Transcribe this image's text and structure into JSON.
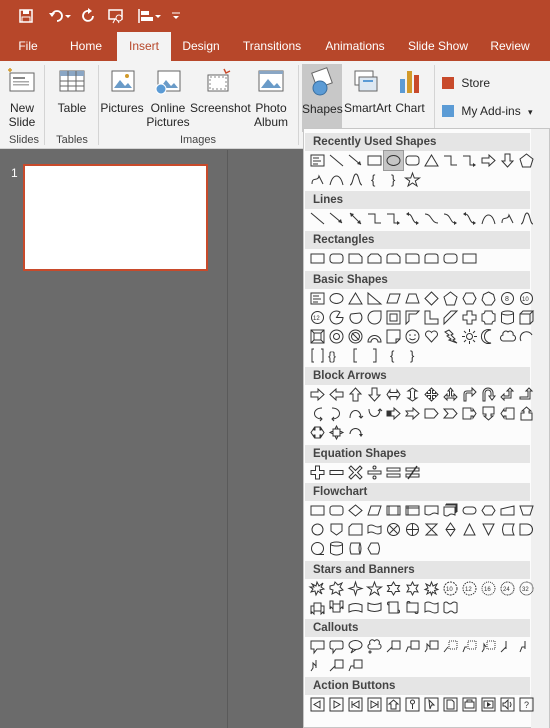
{
  "qat": {
    "save_icon": "save-icon",
    "undo_icon": "undo-icon",
    "redo_icon": "redo-icon",
    "start_icon": "start-from-beginning-icon",
    "align_icon": "align-icon",
    "more_icon": "customize-qat-icon"
  },
  "tabs": [
    "File",
    "Home",
    "Insert",
    "Design",
    "Transitions",
    "Animations",
    "Slide Show",
    "Review"
  ],
  "active_tab": "Insert",
  "ribbon": {
    "new_slide": "New Slide",
    "table": "Table",
    "pictures": "Pictures",
    "online_pictures": "Online Pictures",
    "screenshot": "Screenshot",
    "photo_album": "Photo Album",
    "shapes": "Shapes",
    "smartart": "SmartArt",
    "chart": "Chart",
    "store": "Store",
    "my_addins": "My Add-ins",
    "groups": {
      "slides": "Slides",
      "tables": "Tables",
      "images": "Images"
    }
  },
  "slides": [
    {
      "number": "1"
    }
  ],
  "gallery": {
    "sections": [
      {
        "title": "Recently Used Shapes"
      },
      {
        "title": "Lines"
      },
      {
        "title": "Rectangles"
      },
      {
        "title": "Basic Shapes"
      },
      {
        "title": "Block Arrows"
      },
      {
        "title": "Equation Shapes"
      },
      {
        "title": "Flowchart"
      },
      {
        "title": "Stars and Banners"
      },
      {
        "title": "Callouts"
      },
      {
        "title": "Action Buttons"
      }
    ],
    "colors": {
      "accent": "#b7472a",
      "selected": "#c6c6c6"
    }
  }
}
